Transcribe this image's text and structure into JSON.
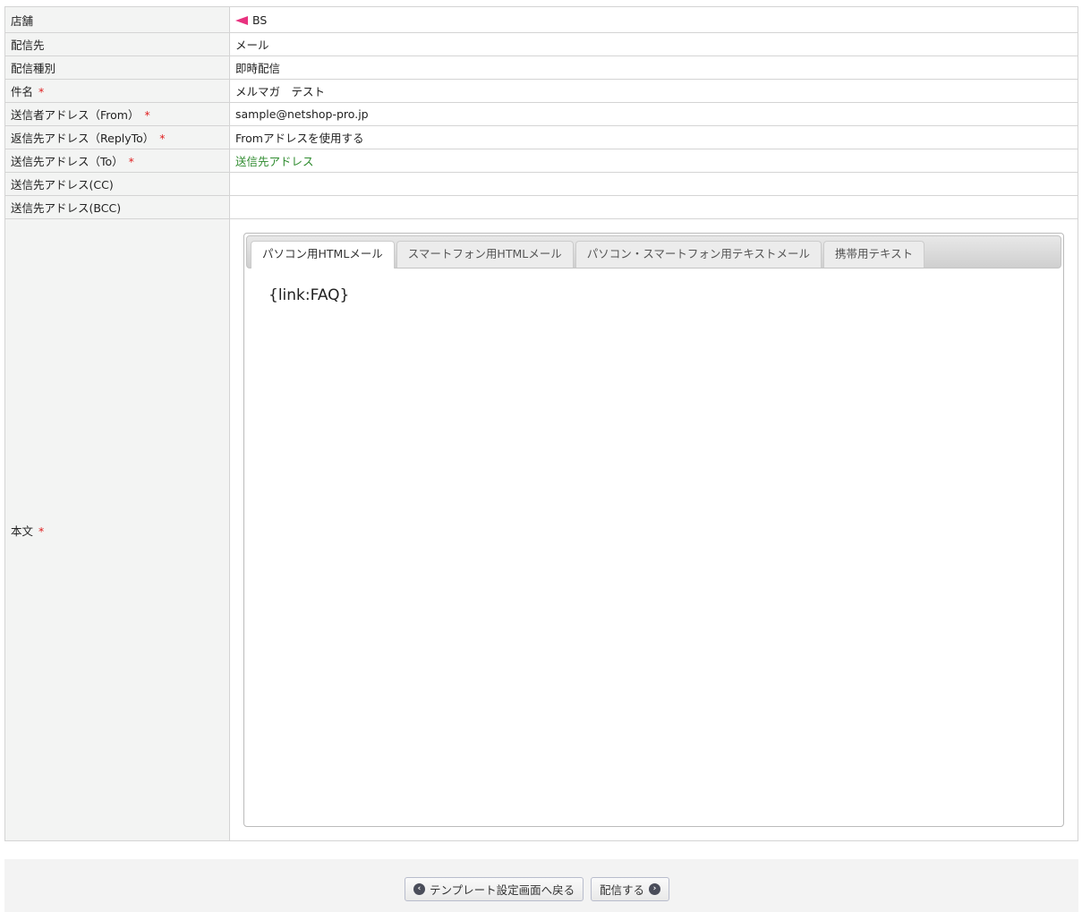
{
  "rows": [
    {
      "label": "店舗",
      "value": "BS",
      "required": false
    },
    {
      "label": "配信先",
      "value": "メール",
      "required": false
    },
    {
      "label": "配信種別",
      "value": "即時配信",
      "required": false
    },
    {
      "label": "件名",
      "value": "メルマガ　テスト",
      "required": true
    },
    {
      "label": "送信者アドレス（From）",
      "value": "sample@netshop-pro.jp",
      "required": true
    },
    {
      "label": "返信先アドレス（ReplyTo）",
      "value": "Fromアドレスを使用する",
      "required": true
    },
    {
      "label": "送信先アドレス（To）",
      "value": "送信先アドレス",
      "required": true
    },
    {
      "label": "送信先アドレス(CC)",
      "value": "",
      "required": false
    },
    {
      "label": "送信先アドレス(BCC)",
      "value": "",
      "required": false
    }
  ],
  "body": {
    "label": "本文",
    "tabs": [
      "パソコン用HTMLメール",
      "スマートフォン用HTMLメール",
      "パソコン・スマートフォン用テキストメール",
      "携帯用テキスト"
    ],
    "content": "{link:FAQ}"
  },
  "required_mark": "*",
  "footer": {
    "back_label": "テンプレート設定画面へ戻る",
    "send_label": "配信する"
  },
  "colors": {
    "flag": "#e8327f",
    "required": "#e02020",
    "link": "#2e8b2e"
  }
}
